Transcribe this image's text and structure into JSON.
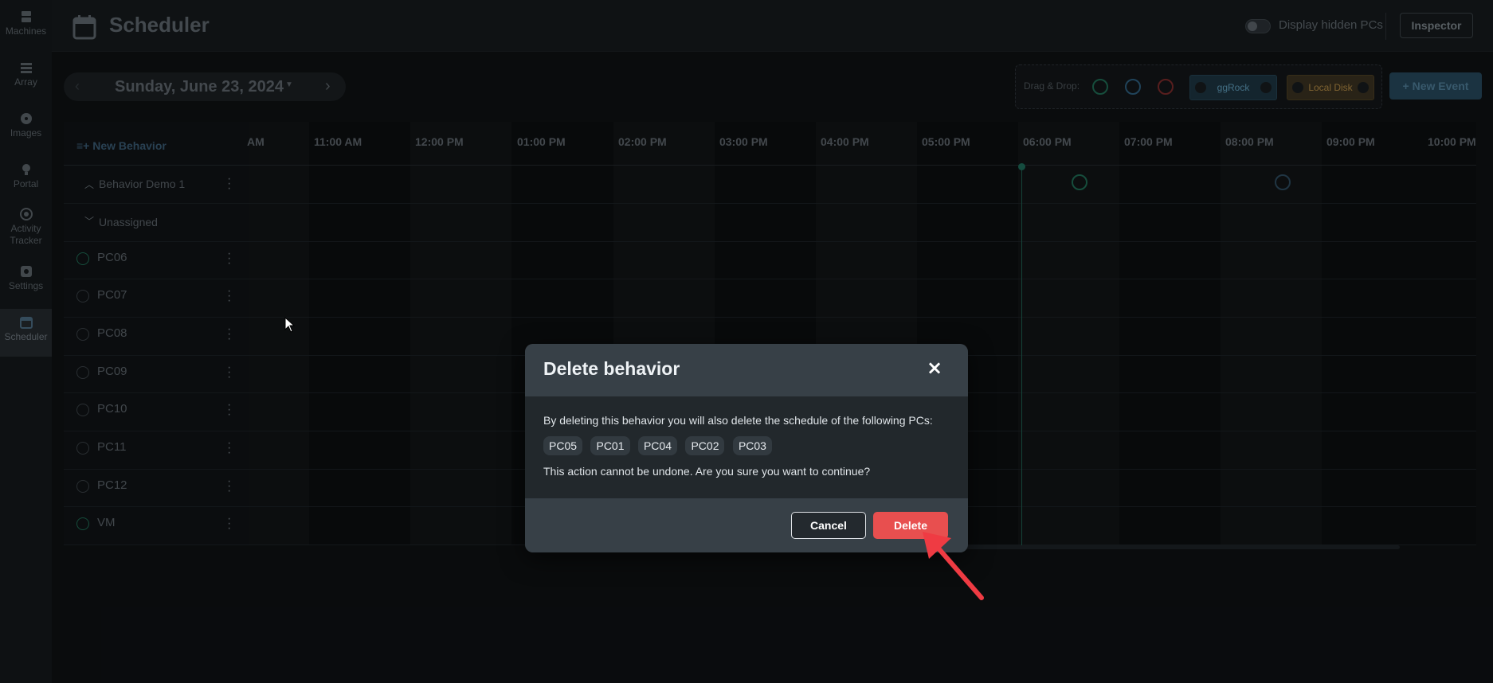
{
  "sidebar": {
    "items": [
      {
        "label": "Machines",
        "icon": "server-icon"
      },
      {
        "label": "Array",
        "icon": "stack-icon"
      },
      {
        "label": "Images",
        "icon": "disc-icon"
      },
      {
        "label": "Portal",
        "icon": "bulb-icon"
      },
      {
        "label": "Activity Tracker",
        "icon": "radar-icon"
      },
      {
        "label": "Settings",
        "icon": "gear-icon"
      },
      {
        "label": "Scheduler",
        "icon": "calendar-icon",
        "active": true
      }
    ]
  },
  "header": {
    "title": "Scheduler",
    "toggle_label": "Display hidden PCs",
    "inspector_label": "Inspector"
  },
  "datenav": {
    "date": "Sunday, June 23, 2024"
  },
  "dragdrop": {
    "label": "Drag & Drop:",
    "chips": [
      "ggRock",
      "Local Disk"
    ]
  },
  "toolbar": {
    "new_event_label": "New Event"
  },
  "timeline": {
    "new_behavior_label": "New Behavior",
    "hours": [
      "AM",
      "11:00 AM",
      "12:00 PM",
      "01:00 PM",
      "02:00 PM",
      "03:00 PM",
      "04:00 PM",
      "05:00 PM",
      "06:00 PM",
      "07:00 PM",
      "08:00 PM",
      "09:00 PM",
      "10:00 PM"
    ],
    "groups": [
      "Behavior Demo 1",
      "Unassigned"
    ],
    "pcs": [
      {
        "name": "PC06",
        "status": "online"
      },
      {
        "name": "PC07",
        "status": "offline"
      },
      {
        "name": "PC08",
        "status": "offline"
      },
      {
        "name": "PC09",
        "status": "offline"
      },
      {
        "name": "PC10",
        "status": "offline"
      },
      {
        "name": "PC11",
        "status": "offline"
      },
      {
        "name": "PC12",
        "status": "offline"
      },
      {
        "name": "VM",
        "status": "online"
      }
    ]
  },
  "modal": {
    "title": "Delete behavior",
    "close": "×",
    "description": "By deleting this behavior you will also delete the schedule of the following PCs:",
    "pcs": [
      "PC05",
      "PC01",
      "PC04",
      "PC02",
      "PC03"
    ],
    "warning": "This action cannot be undone. Are you sure you want to continue?",
    "cancel_label": "Cancel",
    "delete_label": "Delete"
  },
  "colors": {
    "accent_green": "#1f8a6a",
    "danger": "#e84f4f",
    "arrow": "#ef3b43"
  }
}
